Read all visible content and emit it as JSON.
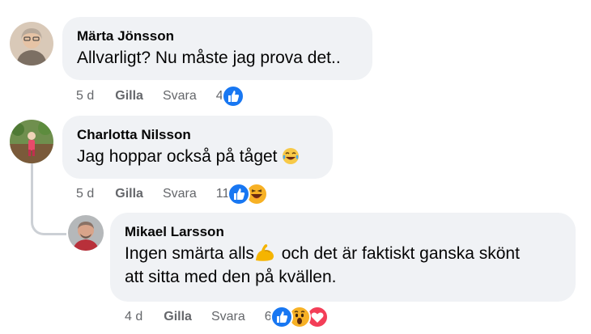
{
  "comments": [
    {
      "author": "Märta Jönsson",
      "text": "Allvarligt? Nu måste jag prova det..",
      "time": "5 d",
      "like_label": "Gilla",
      "reply_label": "Svara",
      "reaction_count": "4",
      "reactions": [
        "like"
      ]
    },
    {
      "author": "Charlotta Nilsson",
      "text": "Jag hoppar också på tåget",
      "text_emoji": "laughing-tears",
      "time": "5 d",
      "like_label": "Gilla",
      "reply_label": "Svara",
      "reaction_count": "11",
      "reactions": [
        "like",
        "haha"
      ]
    },
    {
      "author": "Mikael Larsson",
      "text_part1": "Ingen smärta alls",
      "text_emoji": "flexed-biceps",
      "text_part2": " och det är faktiskt ganska skönt",
      "text_line2": "att sitta med den på kvällen.",
      "time": "4 d",
      "like_label": "Gilla",
      "reply_label": "Svara",
      "reaction_count": "6",
      "reactions": [
        "like",
        "wow",
        "love"
      ]
    }
  ],
  "colors": {
    "bubble": "#f0f2f5",
    "meta_text": "#65676b",
    "like_blue": "#1877f2",
    "love_red": "#f33e58",
    "haha_yellow": "#f7b125"
  }
}
